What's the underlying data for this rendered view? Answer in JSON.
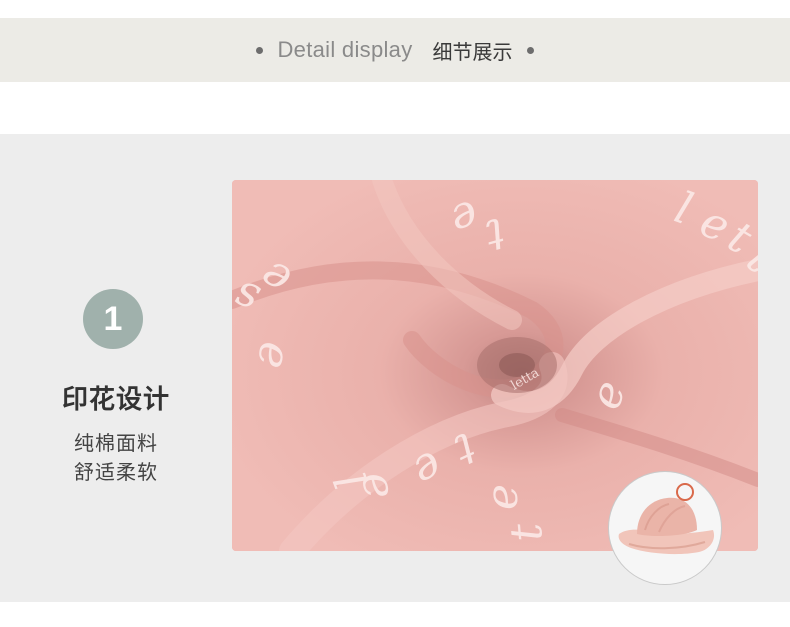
{
  "header": {
    "title_en": "Detail display",
    "title_zh": "细节展示"
  },
  "feature": {
    "number": "1",
    "title": "印花设计",
    "desc_line1": "纯棉面料",
    "desc_line2": "舒适柔软"
  },
  "photo": {
    "print_text": "letta",
    "fabric_color": "#ecb3ad",
    "print_color": "#fbe9e6"
  },
  "thumbnail": {
    "subject": "pink baby hat",
    "highlight_color": "#d9694a"
  },
  "colors": {
    "header_band": "#ecebe6",
    "panel_bg": "#ededed",
    "number_circle": "#a0b1ac"
  }
}
